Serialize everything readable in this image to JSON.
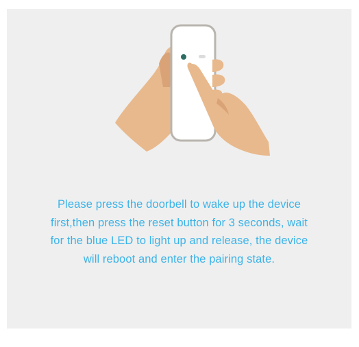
{
  "instruction": {
    "text": "Please press the doorbell to wake up the device first,then press the reset button for 3 seconds, wait for the blue LED to light up and release, the device will reboot and enter the pairing state."
  },
  "illustration": {
    "icon": "hand-pressing-doorbell-icon",
    "skin_color": "#e8b98d",
    "skin_shadow": "#d9a377",
    "device_body": "#ffffff",
    "device_outline": "#b9b4ae",
    "led_color": "#2c6e64"
  },
  "colors": {
    "background": "#efefef",
    "text_accent": "#3bb3e8"
  }
}
